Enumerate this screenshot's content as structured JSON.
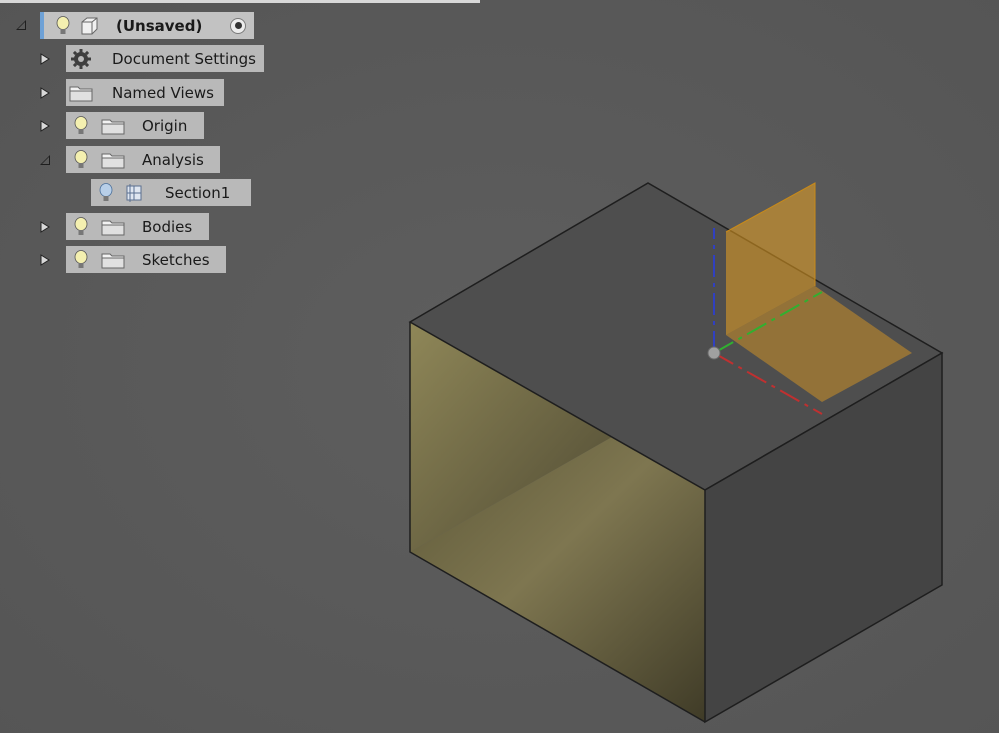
{
  "browser": {
    "root": {
      "label": "(Unsaved)",
      "bulb": "lightbulb-icon",
      "body": "component-icon",
      "activate": "radio-active-icon"
    },
    "items": [
      {
        "label": "Document Settings",
        "icon": "gear-icon",
        "expanded": false,
        "bulb": false
      },
      {
        "label": "Named Views",
        "icon": "folder-icon",
        "expanded": false,
        "bulb": false
      },
      {
        "label": "Origin",
        "icon": "folder-icon",
        "expanded": false,
        "bulb": true
      },
      {
        "label": "Analysis",
        "icon": "folder-icon",
        "expanded": true,
        "bulb": true
      },
      {
        "label": "Section1",
        "icon": "section-analysis-icon",
        "expanded": null,
        "bulb": true
      },
      {
        "label": "Bodies",
        "icon": "folder-icon",
        "expanded": false,
        "bulb": true
      },
      {
        "label": "Sketches",
        "icon": "folder-icon",
        "expanded": false,
        "bulb": true
      }
    ]
  },
  "colors": {
    "background": "#5a5a5a",
    "node_bg": "#b9b9b9",
    "selection_accent": "#6ea1d6",
    "section_plane": "#e8a020",
    "interior_face": "#7a7048",
    "axis_x": "#c03030",
    "axis_y": "#30b030",
    "axis_z": "#3040c0"
  }
}
